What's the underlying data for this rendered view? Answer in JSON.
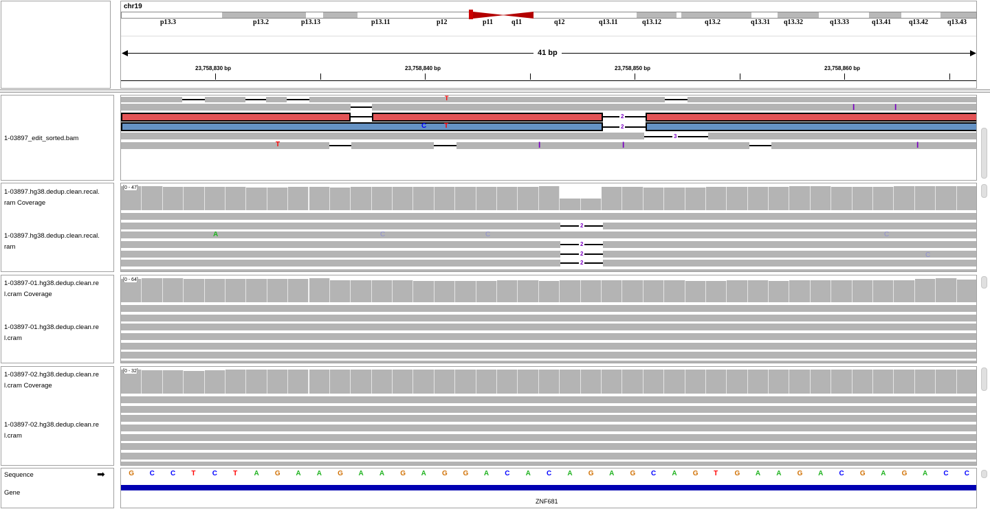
{
  "header": {
    "chromosome": "chr19",
    "span": "41 bp",
    "ticks": [
      "23,758,830 bp",
      "23,758,840 bp",
      "23,758,850 bp",
      "23,758,860 bp"
    ],
    "cytobands": [
      "p13.3",
      "p13.2",
      "p13.13",
      "p13.11",
      "p12",
      "p11",
      "q11",
      "q12",
      "q13.11",
      "q13.12",
      "q13.2",
      "q13.31",
      "q13.32",
      "q13.33",
      "q13.41",
      "q13.42",
      "q13.43"
    ]
  },
  "tracks": {
    "bam": {
      "label": "1-03897_edit_sorted.bam"
    },
    "recal_cov": {
      "label_l1": "1-03897.hg38.dedup.clean.recal.",
      "label_l2": "ram Coverage",
      "range": "[0 - 47]"
    },
    "recal_aln": {
      "label_l1": "1-03897.hg38.dedup.clean.recal.",
      "label_l2": "ram"
    },
    "s01_cov": {
      "label_l1": "1-03897-01.hg38.dedup.clean.re",
      "label_l2": "l.cram Coverage",
      "range": "[0 - 64]"
    },
    "s01_aln": {
      "label_l1": "1-03897-01.hg38.dedup.clean.re",
      "label_l2": "l.cram"
    },
    "s02_cov": {
      "label_l1": "1-03897-02.hg38.dedup.clean.re",
      "label_l2": "l.cram Coverage",
      "range": "[0 - 32]"
    },
    "s02_aln": {
      "label_l1": "1-03897-02.hg38.dedup.clean.re",
      "label_l2": "l.cram"
    }
  },
  "bottom": {
    "sequence_label": "Sequence",
    "sequence_arrow": "➡",
    "gene_label": "Gene",
    "gene_name": "ZNF681",
    "sequence": [
      "G",
      "C",
      "C",
      "T",
      "C",
      "T",
      "A",
      "G",
      "A",
      "A",
      "G",
      "A",
      "A",
      "G",
      "A",
      "G",
      "G",
      "A",
      "C",
      "A",
      "C",
      "A",
      "G",
      "A",
      "G",
      "C",
      "A",
      "G",
      "T",
      "G",
      "A",
      "A",
      "G",
      "A",
      "C",
      "G",
      "A",
      "G",
      "A",
      "C",
      "C"
    ]
  },
  "indels": {
    "bam_del_a": "2",
    "bam_del_b": "2",
    "bam_del_c": "3",
    "recal_del_a": "2",
    "recal_del_b": "2",
    "recal_del_c": "2",
    "recal_del_d": "2"
  },
  "mismatches": {
    "bam_top_t": "T",
    "bam_c": "C",
    "bam_t2": "T",
    "bam_t3": "T",
    "insertion": "I",
    "recal_a": "A",
    "recal_c1": "C",
    "recal_c2": "C",
    "recal_c3": "C",
    "recal_c4": "C"
  },
  "coverage": {
    "recal": [
      0.94,
      0.94,
      0.92,
      0.92,
      0.92,
      0.92,
      0.9,
      0.9,
      0.92,
      0.92,
      0.9,
      0.92,
      0.92,
      0.92,
      0.92,
      0.92,
      0.92,
      0.92,
      0.92,
      0.92,
      0.94,
      0.48,
      0.48,
      0.92,
      0.92,
      0.9,
      0.9,
      0.9,
      0.92,
      0.92,
      0.92,
      0.92,
      0.94,
      0.94,
      0.92,
      0.92,
      0.92,
      0.94,
      0.96,
      0.96,
      0.94
    ],
    "s01": [
      0.92,
      0.96,
      0.94,
      0.92,
      0.92,
      0.92,
      0.92,
      0.92,
      0.92,
      0.94,
      0.86,
      0.86,
      0.86,
      0.86,
      0.84,
      0.84,
      0.84,
      0.84,
      0.86,
      0.86,
      0.84,
      0.88,
      0.88,
      0.86,
      0.86,
      0.86,
      0.86,
      0.84,
      0.84,
      0.86,
      0.86,
      0.84,
      0.88,
      0.86,
      0.88,
      0.88,
      0.86,
      0.86,
      0.92,
      0.94,
      0.9
    ],
    "s02": [
      0.94,
      0.92,
      0.92,
      0.9,
      0.92,
      0.94,
      0.96,
      0.96,
      0.96,
      0.96,
      0.96,
      0.96,
      0.96,
      0.96,
      0.96,
      0.96,
      0.96,
      0.96,
      0.96,
      0.96,
      0.96,
      0.96,
      0.96,
      0.96,
      0.96,
      0.96,
      0.96,
      0.96,
      0.96,
      0.96,
      0.96,
      0.96,
      0.96,
      0.96,
      0.96,
      0.94,
      0.96,
      0.96,
      0.96,
      0.96,
      0.96
    ]
  },
  "colors": {
    "A": "#22b322",
    "C": "#0000ff",
    "G": "#d17104",
    "T": "#ff0000",
    "read_fwd": "#e35456",
    "read_rev": "#6592c4",
    "read_gray": "#c8c8c8",
    "gene": "#0000b2",
    "insertion": "#7a00c2",
    "faint_c": "#9090d0"
  }
}
